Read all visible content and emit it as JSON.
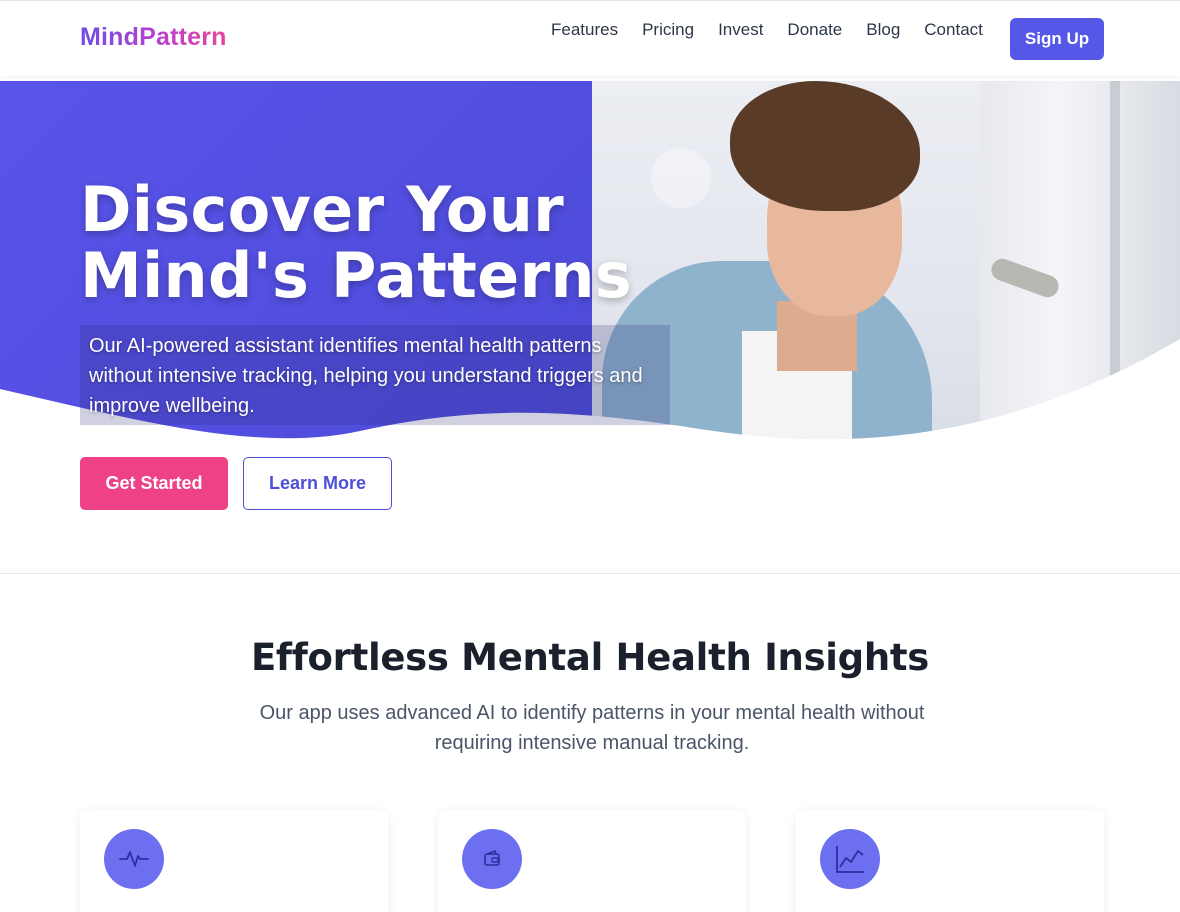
{
  "header": {
    "logo": "MindPattern",
    "nav": [
      "Features",
      "Pricing",
      "Invest",
      "Donate",
      "Blog",
      "Contact"
    ],
    "signup_label": "Sign Up"
  },
  "hero": {
    "title_line1": "Discover Your",
    "title_line2": "Mind's Patterns",
    "subtitle": "Our AI-powered assistant identifies mental health patterns without intensive tracking, helping you understand triggers and improve wellbeing.",
    "primary_cta": "Get Started",
    "secondary_cta": "Learn More"
  },
  "features": {
    "title": "Effortless Mental Health Insights",
    "subtitle": "Our app uses advanced AI to identify patterns in your mental health without requiring intensive manual tracking.",
    "cards": [
      {
        "icon": "pulse-icon"
      },
      {
        "icon": "wallet-icon"
      },
      {
        "icon": "chart-line-icon"
      }
    ]
  },
  "colors": {
    "brand_primary": "#5457e8",
    "accent_pink": "#ef4286",
    "hero_blue": "#5a54ea",
    "icon_circle": "#6c6ff0"
  }
}
